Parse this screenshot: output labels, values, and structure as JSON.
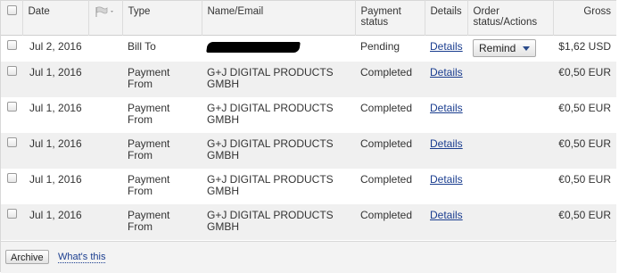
{
  "header": {
    "date": "Date",
    "flag_icon": "flag-icon",
    "type": "Type",
    "name_email": "Name/Email",
    "payment_status": "Payment status",
    "details": "Details",
    "order_status": "Order status/Actions",
    "gross": "Gross"
  },
  "rows": [
    {
      "date": "Jul 2, 2016",
      "type": "Bill To",
      "name": "",
      "status": "Pending",
      "details": "Details",
      "action": "Remind",
      "gross": "$1,62 USD"
    },
    {
      "date": "Jul 1, 2016",
      "type": "Payment From",
      "name": "G+J DIGITAL PRODUCTS GMBH",
      "status": "Completed",
      "details": "Details",
      "action": "",
      "gross": "€0,50 EUR"
    },
    {
      "date": "Jul 1, 2016",
      "type": "Payment From",
      "name": "G+J DIGITAL PRODUCTS GMBH",
      "status": "Completed",
      "details": "Details",
      "action": "",
      "gross": "€0,50 EUR"
    },
    {
      "date": "Jul 1, 2016",
      "type": "Payment From",
      "name": "G+J DIGITAL PRODUCTS GMBH",
      "status": "Completed",
      "details": "Details",
      "action": "",
      "gross": "€0,50 EUR"
    },
    {
      "date": "Jul 1, 2016",
      "type": "Payment From",
      "name": "G+J DIGITAL PRODUCTS GMBH",
      "status": "Completed",
      "details": "Details",
      "action": "",
      "gross": "€0,50 EUR"
    },
    {
      "date": "Jul 1, 2016",
      "type": "Payment From",
      "name": "G+J DIGITAL PRODUCTS GMBH",
      "status": "Completed",
      "details": "Details",
      "action": "",
      "gross": "€0,50 EUR"
    }
  ],
  "footer": {
    "archive_label": "Archive",
    "whats_this": "What's this"
  },
  "colors": {
    "link": "#1a3d8f",
    "header_bg": "#f3f3f3",
    "alt_row_bg": "#f0f0f0"
  }
}
